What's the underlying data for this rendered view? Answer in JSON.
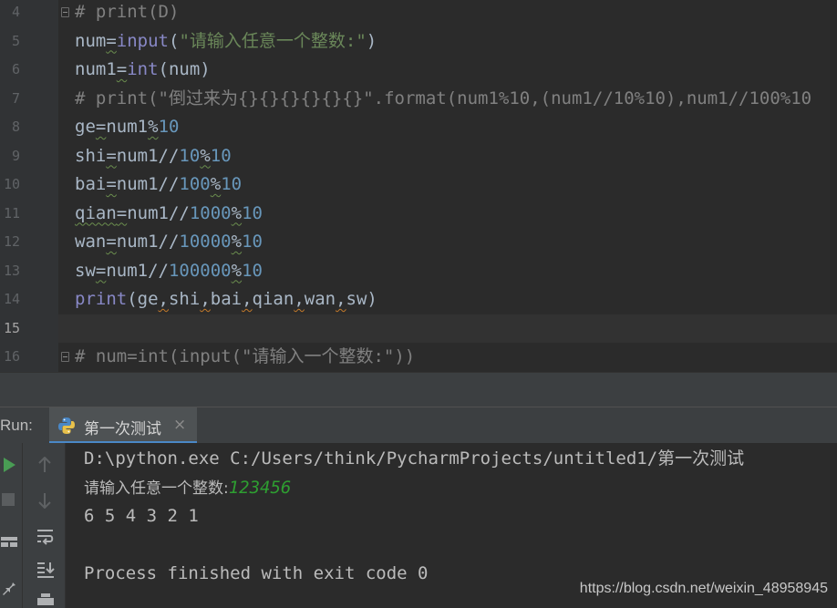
{
  "editor": {
    "lines": [
      {
        "num": "4",
        "tokens": [
          {
            "t": "# print(D)",
            "c": "cmt"
          }
        ]
      },
      {
        "num": "5",
        "tokens": [
          {
            "t": "num",
            "c": ""
          },
          {
            "t": "=",
            "c": "warn"
          },
          {
            "t": "input",
            "c": "bi"
          },
          {
            "t": "(",
            "c": ""
          },
          {
            "t": "\"请输入任意一个整数:\"",
            "c": "str"
          },
          {
            "t": ")",
            "c": ""
          }
        ]
      },
      {
        "num": "6",
        "tokens": [
          {
            "t": "num1",
            "c": ""
          },
          {
            "t": "=",
            "c": "warn"
          },
          {
            "t": "int",
            "c": "bi"
          },
          {
            "t": "(num)",
            "c": ""
          }
        ]
      },
      {
        "num": "7",
        "tokens": [
          {
            "t": "# print(\"倒过来为{}{}{}{}{}{}\".format(num1%10,(num1//10%10),num1//100%10",
            "c": "cmt"
          }
        ]
      },
      {
        "num": "8",
        "tokens": [
          {
            "t": "ge",
            "c": ""
          },
          {
            "t": "=",
            "c": "warn"
          },
          {
            "t": "num1",
            "c": ""
          },
          {
            "t": "%",
            "c": "warn"
          },
          {
            "t": "10",
            "c": "num"
          }
        ]
      },
      {
        "num": "9",
        "tokens": [
          {
            "t": "shi",
            "c": ""
          },
          {
            "t": "=",
            "c": "warn"
          },
          {
            "t": "num1//",
            "c": ""
          },
          {
            "t": "10",
            "c": "num"
          },
          {
            "t": "%",
            "c": "warn"
          },
          {
            "t": "10",
            "c": "num"
          }
        ]
      },
      {
        "num": "10",
        "tokens": [
          {
            "t": "bai",
            "c": ""
          },
          {
            "t": "=",
            "c": "warn"
          },
          {
            "t": "num1//",
            "c": ""
          },
          {
            "t": "100",
            "c": "num"
          },
          {
            "t": "%",
            "c": "warn"
          },
          {
            "t": "10",
            "c": "num"
          }
        ]
      },
      {
        "num": "11",
        "tokens": [
          {
            "t": "qian",
            "c": "warn"
          },
          {
            "t": "=",
            "c": "warn"
          },
          {
            "t": "num1//",
            "c": ""
          },
          {
            "t": "1000",
            "c": "num"
          },
          {
            "t": "%",
            "c": "warn"
          },
          {
            "t": "10",
            "c": "num"
          }
        ]
      },
      {
        "num": "12",
        "tokens": [
          {
            "t": "wan",
            "c": ""
          },
          {
            "t": "=",
            "c": "warn"
          },
          {
            "t": "num1//",
            "c": ""
          },
          {
            "t": "10000",
            "c": "num"
          },
          {
            "t": "%",
            "c": "warn"
          },
          {
            "t": "10",
            "c": "num"
          }
        ]
      },
      {
        "num": "13",
        "tokens": [
          {
            "t": "sw",
            "c": ""
          },
          {
            "t": "=",
            "c": "warn"
          },
          {
            "t": "num1//",
            "c": ""
          },
          {
            "t": "100000",
            "c": "num"
          },
          {
            "t": "%",
            "c": "warn"
          },
          {
            "t": "10",
            "c": "num"
          }
        ]
      },
      {
        "num": "14",
        "tokens": [
          {
            "t": "print",
            "c": "bi"
          },
          {
            "t": "(ge",
            "c": ""
          },
          {
            "t": ",",
            "c": "warn-o"
          },
          {
            "t": "shi",
            "c": ""
          },
          {
            "t": ",",
            "c": "warn-o"
          },
          {
            "t": "bai",
            "c": ""
          },
          {
            "t": ",",
            "c": "warn-o"
          },
          {
            "t": "qian",
            "c": ""
          },
          {
            "t": ",",
            "c": "warn-o"
          },
          {
            "t": "wan",
            "c": ""
          },
          {
            "t": ",",
            "c": "warn-o"
          },
          {
            "t": "sw)",
            "c": ""
          }
        ]
      },
      {
        "num": "15",
        "tokens": []
      },
      {
        "num": "16",
        "tokens": [
          {
            "t": "# num=int(input(\"请输入一个整数:\"))",
            "c": "cmt"
          }
        ]
      }
    ],
    "current_line": "15",
    "fold_lines": [
      "4",
      "16"
    ]
  },
  "run_panel": {
    "label": "Run:",
    "tab_title": "第一次测试",
    "tab_close": "×",
    "console": {
      "command": "D:\\python.exe C:/Users/think/PycharmProjects/untitled1/第一次测试",
      "prompt": "请输入任意一个整数:",
      "user_input": "123456",
      "output": "6 5 4 3 2 1",
      "exit_message": "Process finished with exit code 0"
    }
  },
  "watermark": "https://blog.csdn.net/weixin_48958945",
  "colors": {
    "background": "#2b2b2b",
    "comment": "#808080",
    "string": "#6a8759",
    "number": "#6897bb",
    "builtin": "#8888c6",
    "run_green": "#499c54",
    "input_green": "#2e9e31"
  }
}
